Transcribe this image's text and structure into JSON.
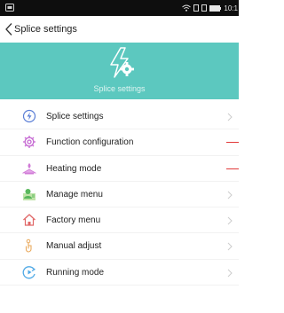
{
  "status_bar": {
    "icons": [
      "notification-icon",
      "wifi-icon",
      "sim-icon",
      "battery-icon"
    ],
    "time": "10:1"
  },
  "header": {
    "title": "Splice settings",
    "back_icon": "chevron-left-icon"
  },
  "hero": {
    "title": "Splice settings",
    "icon": "lightning-gear-icon",
    "background": "#5cc8bf"
  },
  "menu": {
    "items": [
      {
        "label": "Splice settings",
        "icon": "lightning-circle-icon",
        "color": "#5b7fd6"
      },
      {
        "label": "Function configuration",
        "icon": "gear-icon",
        "color": "#c66bd3"
      },
      {
        "label": "Heating mode",
        "icon": "heater-icon",
        "color": "#d07ad6"
      },
      {
        "label": "Manage menu",
        "icon": "user-manage-icon",
        "color": "#59b85c"
      },
      {
        "label": "Factory menu",
        "icon": "factory-house-icon",
        "color": "#e06767"
      },
      {
        "label": "Manual adjust",
        "icon": "hand-adjust-icon",
        "color": "#e9a85b"
      },
      {
        "label": "Running mode",
        "icon": "running-circle-icon",
        "color": "#4fa9e6"
      }
    ]
  },
  "colors": {
    "accent": "#5cc8bf",
    "status_bar": "#0e0e0e",
    "marker_red": "#e23a3a"
  }
}
